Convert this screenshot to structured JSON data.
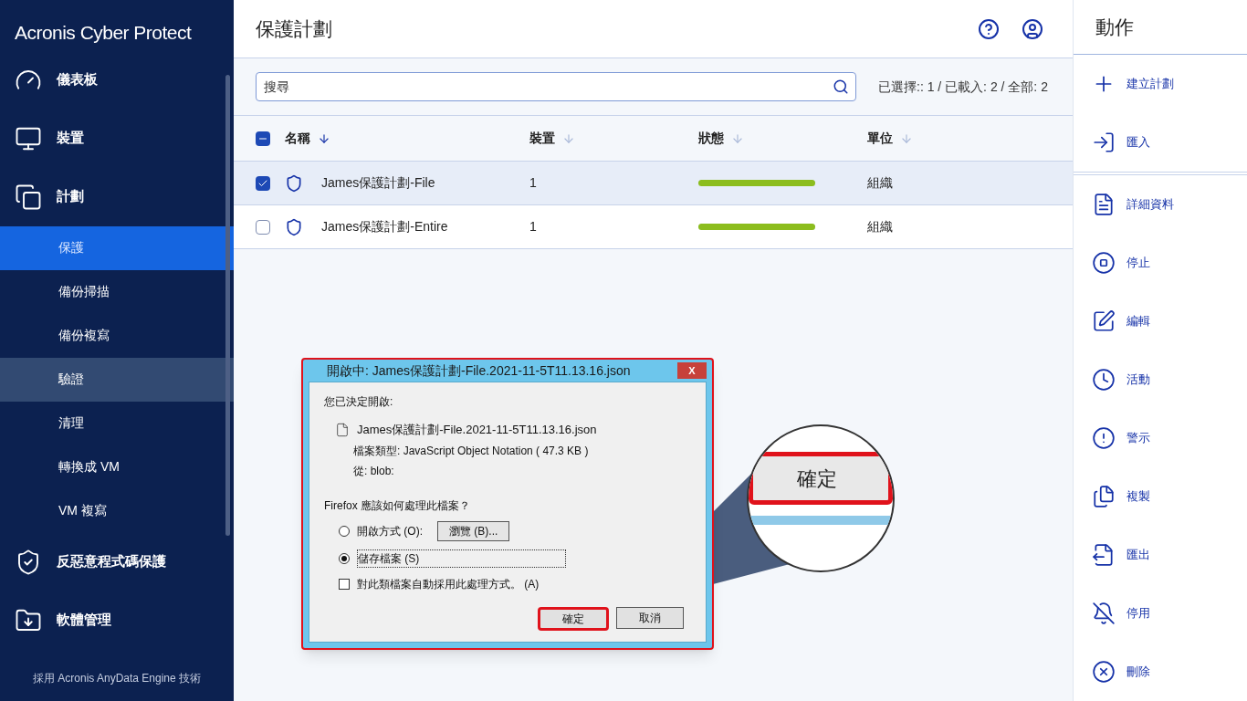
{
  "sidebar": {
    "logo": "Acronis Cyber Protect",
    "items": [
      {
        "kind": "main",
        "label": "儀表板",
        "selected": false,
        "hovered": false
      },
      {
        "kind": "main",
        "label": "裝置",
        "selected": false,
        "hovered": false
      },
      {
        "kind": "main",
        "label": "計劃",
        "selected": false,
        "hovered": false
      },
      {
        "kind": "sub",
        "label": "保護",
        "selected": true,
        "hovered": false
      },
      {
        "kind": "sub",
        "label": "備份掃描",
        "selected": false,
        "hovered": false
      },
      {
        "kind": "sub",
        "label": "備份複寫",
        "selected": false,
        "hovered": false
      },
      {
        "kind": "sub",
        "label": "驗證",
        "selected": false,
        "hovered": true
      },
      {
        "kind": "sub",
        "label": "清理",
        "selected": false,
        "hovered": false
      },
      {
        "kind": "sub",
        "label": "轉換成 VM",
        "selected": false,
        "hovered": false
      },
      {
        "kind": "sub",
        "label": "VM 複寫",
        "selected": false,
        "hovered": false
      },
      {
        "kind": "main",
        "label": "反惡意程式碼保護",
        "selected": false,
        "hovered": false
      },
      {
        "kind": "main",
        "label": "軟體管理",
        "selected": false,
        "hovered": false
      }
    ],
    "footer": "採用 Acronis AnyData Engine 技術"
  },
  "header": {
    "title": "保護計劃"
  },
  "search": {
    "placeholder": "搜尋"
  },
  "counts": "已選擇:: 1 / 已載入: 2 / 全部: 2",
  "table": {
    "indeterminate": true,
    "columns": [
      {
        "label": "名稱",
        "sorted": true
      },
      {
        "label": "裝置",
        "sorted": false
      },
      {
        "label": "狀態",
        "sorted": false
      },
      {
        "label": "單位",
        "sorted": false
      }
    ],
    "rows": [
      {
        "name": "James保護計劃-File",
        "devices": "1",
        "status": {
          "level": 1
        },
        "unit": "組織",
        "selected": true
      },
      {
        "name": "James保護計劃-Entire",
        "devices": "1",
        "status": {
          "level": 1
        },
        "unit": "組織",
        "selected": false
      }
    ]
  },
  "actions": {
    "title": "動作",
    "groups": [
      {
        "items": [
          {
            "label": "建立計劃"
          },
          {
            "label": "匯入"
          }
        ]
      },
      {
        "items": [
          {
            "label": "詳細資料"
          },
          {
            "label": "停止"
          },
          {
            "label": "編輯"
          },
          {
            "label": "活動"
          },
          {
            "label": "警示"
          },
          {
            "label": "複製"
          },
          {
            "label": "匯出"
          },
          {
            "label": "停用"
          },
          {
            "label": "刪除"
          }
        ]
      }
    ]
  },
  "dialog": {
    "title": "開啟中: James保護計劃-File.2021-11-5T11.13.16.json",
    "close": "X",
    "intro": "您已決定開啟:",
    "file": "James保護計劃-File.2021-11-5T11.13.16.json",
    "type_line": "檔案類型: JavaScript Object Notation ( 47.3 KB )",
    "from_line": "從: blob:",
    "question": "Firefox 應該如何處理此檔案？",
    "options": [
      {
        "label": "開啟方式 (O):",
        "selected": false
      },
      {
        "label": "儲存檔案 (S)",
        "selected": true
      }
    ],
    "browse": "瀏覽 (B)...",
    "auto": {
      "label": "對此類檔案自動採用此處理方式。 (A)",
      "checked": false
    },
    "ok": "確定",
    "cancel": "取消"
  },
  "callout": {
    "label": "確定"
  }
}
